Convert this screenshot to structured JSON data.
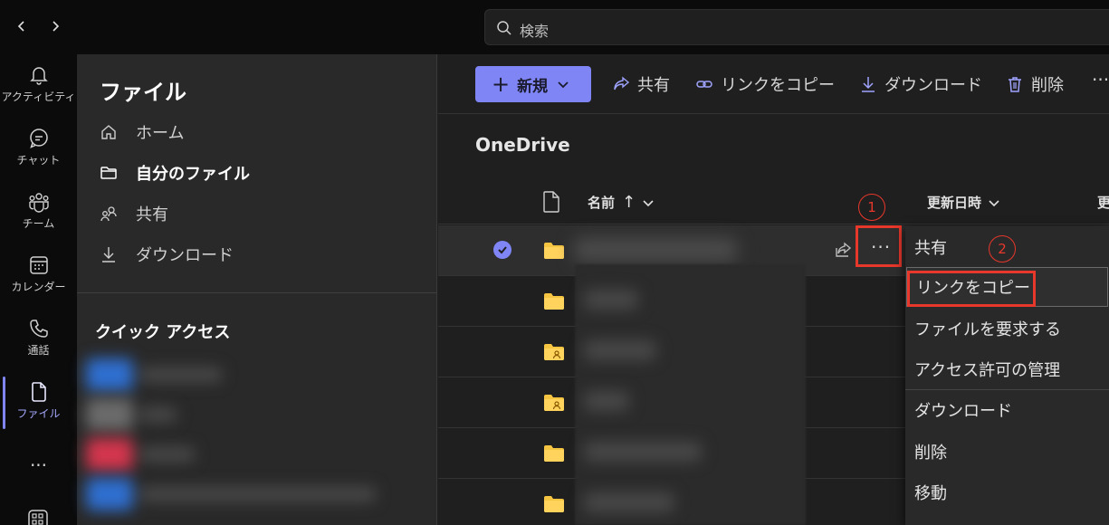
{
  "topbar": {
    "search_placeholder": "検索"
  },
  "rail": {
    "items": [
      {
        "label": "アクティビティ",
        "icon": "bell-icon"
      },
      {
        "label": "チャット",
        "icon": "chat-icon"
      },
      {
        "label": "チーム",
        "icon": "teams-icon"
      },
      {
        "label": "カレンダー",
        "icon": "calendar-icon"
      },
      {
        "label": "通話",
        "icon": "phone-icon"
      },
      {
        "label": "ファイル",
        "icon": "file-icon"
      }
    ],
    "more": "···",
    "accent": "#7f85f5"
  },
  "sidebar": {
    "title": "ファイル",
    "items": [
      {
        "label": "ホーム",
        "icon": "home-icon"
      },
      {
        "label": "自分のファイル",
        "icon": "folder-icon"
      },
      {
        "label": "共有",
        "icon": "people-icon"
      },
      {
        "label": "ダウンロード",
        "icon": "download-icon"
      }
    ],
    "quick_access_title": "クイック アクセス"
  },
  "toolbar": {
    "new_label": "新規",
    "share_label": "共有",
    "copy_link_label": "リンクをコピー",
    "download_label": "ダウンロード",
    "delete_label": "削除",
    "more": "···"
  },
  "breadcrumb": "OneDrive",
  "columns": {
    "name": "名前",
    "sort_arrow": "↑",
    "modified": "更新日時",
    "partial": "更"
  },
  "row_more": "···",
  "context_menu": {
    "items": [
      "共有",
      "リンクをコピー",
      "ファイルを要求する",
      "アクセス許可の管理",
      "ダウンロード",
      "削除",
      "移動"
    ]
  },
  "annotations": {
    "step1": "1",
    "step2": "2",
    "color": "#e8372b"
  }
}
